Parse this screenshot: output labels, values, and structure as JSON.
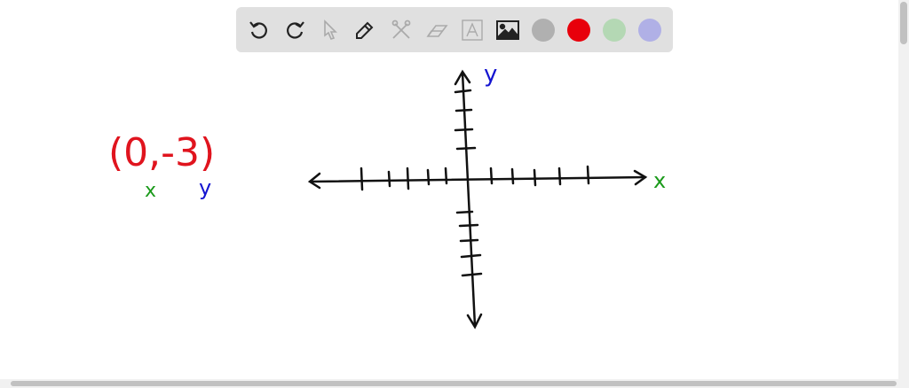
{
  "toolbar": {
    "tools": [
      "undo-icon",
      "redo-icon",
      "pointer-icon",
      "pencil-icon",
      "tools-icon",
      "eraser-icon",
      "text-icon",
      "image-icon"
    ],
    "colors": {
      "gray": "#b0b0b0",
      "red": "#e8000b",
      "green": "#b4d8b4",
      "blue": "#b0b0e6"
    }
  },
  "board": {
    "point_label": "(0,-3)",
    "point_x_caption": "x",
    "point_y_caption": "y",
    "axis_y_label": "y",
    "axis_x_label": "x",
    "ink": {
      "red": "#e0141e",
      "green": "#1a9a1a",
      "blue": "#1414d0",
      "black": "#111111"
    }
  }
}
